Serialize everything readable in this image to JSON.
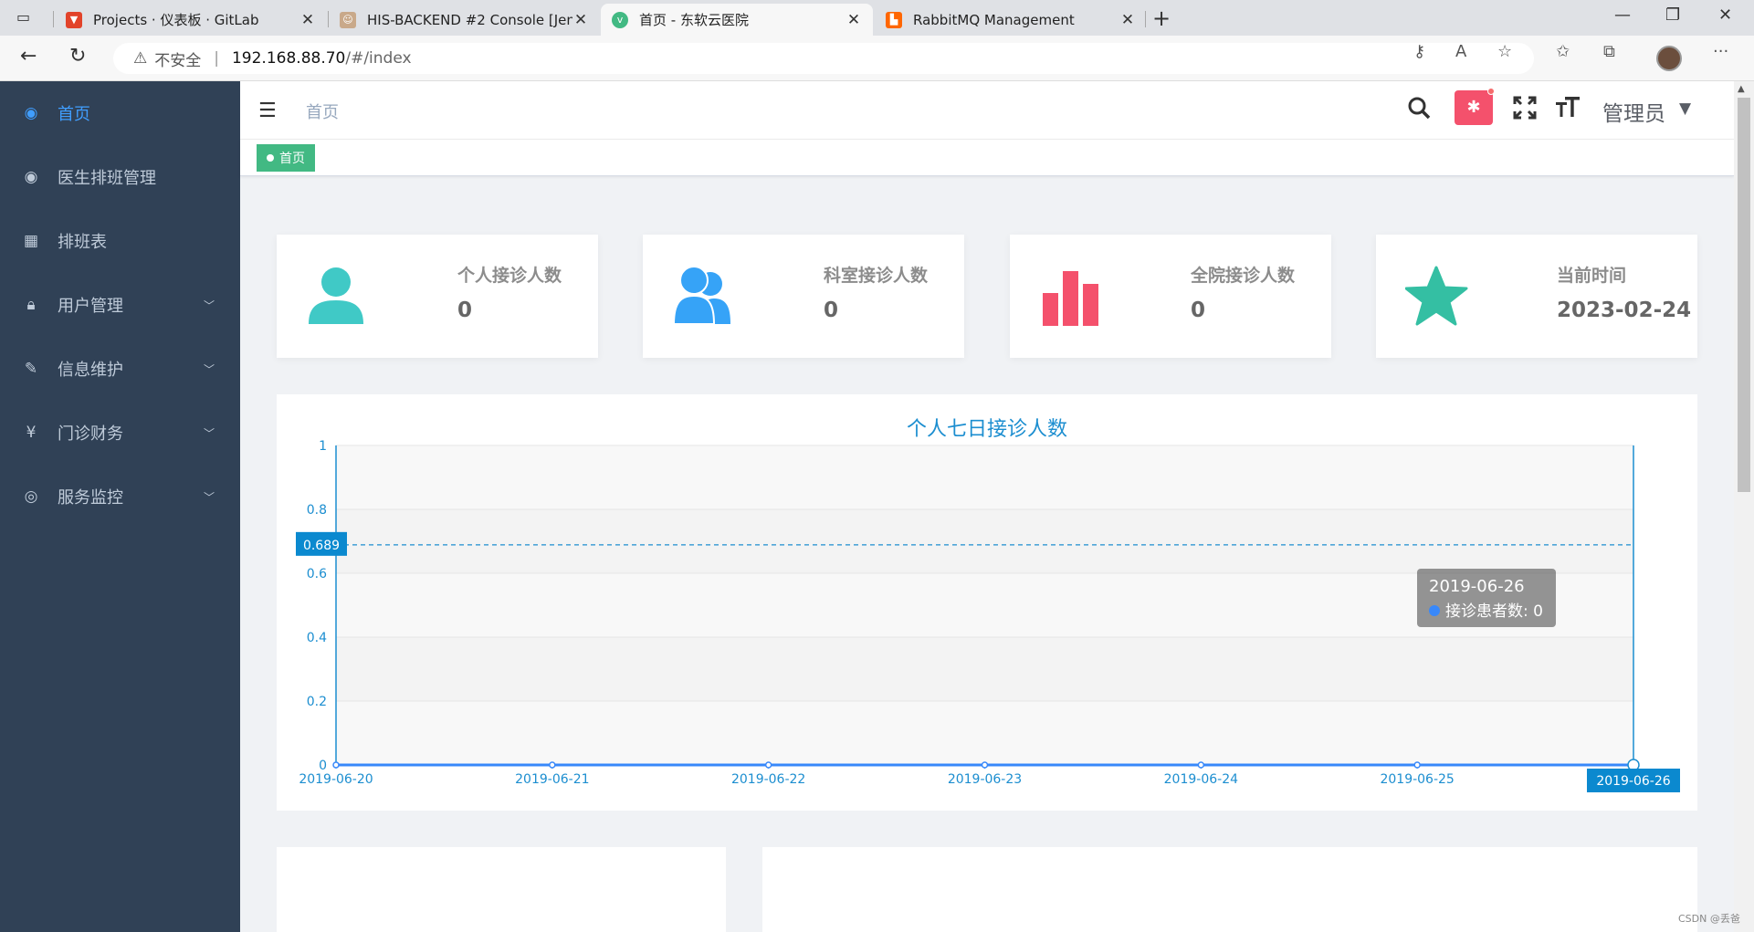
{
  "browser": {
    "tabs": [
      {
        "title": "Projects · 仪表板 · GitLab",
        "icon_color": "#e2432a",
        "icon": "gitlab-icon"
      },
      {
        "title": "HIS-BACKEND #2 Console [Jenkins]",
        "icon_color": "#c9a98a",
        "icon": "jenkins-icon"
      },
      {
        "title": "首页 - 东软云医院",
        "icon_color": "#42b983",
        "icon": "vue-icon"
      },
      {
        "title": "RabbitMQ Management",
        "icon_color": "#ff6600",
        "icon": "rabbitmq-icon"
      }
    ],
    "active_tab": 2,
    "address": {
      "security_label": "不安全",
      "host": "192.168.88.70",
      "path": "/#/index"
    }
  },
  "sidebar": {
    "items": [
      {
        "label": "首页",
        "icon": "dashboard-icon",
        "glyph": "◉",
        "active": true,
        "has_children": false
      },
      {
        "label": "医生排班管理",
        "icon": "dashboard-icon",
        "glyph": "◉",
        "active": false,
        "has_children": false
      },
      {
        "label": "排班表",
        "icon": "table-icon",
        "glyph": "▦",
        "active": false,
        "has_children": false
      },
      {
        "label": "用户管理",
        "icon": "lock-icon",
        "glyph": "🔒︎",
        "active": false,
        "has_children": true
      },
      {
        "label": "信息维护",
        "icon": "edit-icon",
        "glyph": "✎",
        "active": false,
        "has_children": true
      },
      {
        "label": "门诊财务",
        "icon": "yen-icon",
        "glyph": "¥",
        "active": false,
        "has_children": true
      },
      {
        "label": "服务监控",
        "icon": "eye-icon",
        "glyph": "◎",
        "active": false,
        "has_children": true
      }
    ]
  },
  "header": {
    "breadcrumb": "首页",
    "user_name": "管理员"
  },
  "tags": {
    "active_tag": "首页"
  },
  "cards": [
    {
      "title": "个人接诊人数",
      "value": "0",
      "icon": "user-icon",
      "color": "#40c9c6"
    },
    {
      "title": "科室接诊人数",
      "value": "0",
      "icon": "people-icon",
      "color": "#36a3f7"
    },
    {
      "title": "全院接诊人数",
      "value": "0",
      "icon": "chart-bar-icon",
      "color": "#f4516c"
    },
    {
      "title": "当前时间",
      "value": "2023-02-24",
      "icon": "star-icon",
      "color": "#34bfa3"
    }
  ],
  "chart_data": {
    "type": "line",
    "title": "个人七日接诊人数",
    "categories": [
      "2019-06-20",
      "2019-06-21",
      "2019-06-22",
      "2019-06-23",
      "2019-06-24",
      "2019-06-25",
      "2019-06-26"
    ],
    "series": [
      {
        "name": "接诊患者数",
        "values": [
          0,
          0,
          0,
          0,
          0,
          0,
          0
        ],
        "color": "#3888fa"
      }
    ],
    "ylim": [
      0,
      1
    ],
    "yticks": [
      "0",
      "0.2",
      "0.4",
      "0.6",
      "0.8",
      "1"
    ],
    "pointer_y_label": "0.689",
    "pointer_x_label": "2019-06-26",
    "tooltip": {
      "date": "2019-06-26",
      "series_label": "接诊患者数",
      "value": "0"
    },
    "axis_color": "#1c8ed0"
  },
  "footer": {
    "watermark": "CSDN @丢爸"
  }
}
